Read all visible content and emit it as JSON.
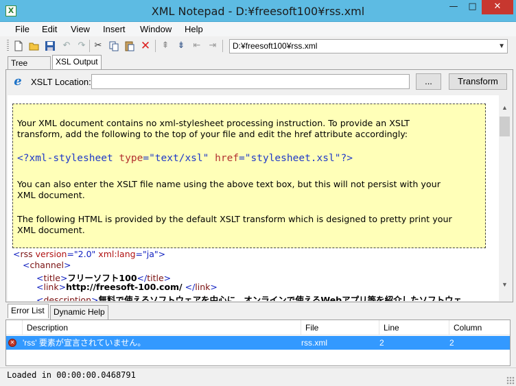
{
  "window": {
    "app_icon": "X",
    "title": "XML Notepad - D:¥freesoft100¥rss.xml",
    "minimize": "—",
    "maximize": "□",
    "close": "✕"
  },
  "menu": [
    "File",
    "Edit",
    "View",
    "Insert",
    "Window",
    "Help"
  ],
  "toolbar": {
    "icons": [
      "new-file-icon",
      "open-folder-icon",
      "save-icon",
      "undo-icon",
      "redo-icon",
      "cut-icon",
      "copy-icon",
      "paste-icon",
      "delete-icon",
      "nudge-up-icon",
      "nudge-down-icon",
      "nudge-left-icon",
      "nudge-right-icon"
    ],
    "path": "D:¥freesoft100¥rss.xml"
  },
  "tabs": [
    "Tree View",
    "XSL Output"
  ],
  "xslt": {
    "label": "XSLT Location:",
    "value": "",
    "browse_button": "...",
    "transform_button": "Transform"
  },
  "notice": {
    "line1": "Your XML document contains no xml-stylesheet processing instruction. To provide an XSLT",
    "line2": "transform, add the following to the top of your file and edit the href attribute accordingly:",
    "pi": {
      "open": "<?xml-stylesheet",
      "attr1": "type",
      "val1": "\"text/xsl\"",
      "attr2": "href",
      "val2": "\"stylesheet.xsl\"",
      "close": "?>"
    },
    "line3": "You can also enter the XSLT file name using the above text box, but this will not persist with your",
    "line4": "XML document.",
    "line5": "The following HTML is provided by the default XSLT transform which is designed to pretty print your",
    "line6": "XML document."
  },
  "xml": {
    "rss_tag": "rss",
    "rss_attr1": "version",
    "rss_val1": "\"2.0\"",
    "rss_attr2": "xml:lang",
    "rss_val2": "\"ja\"",
    "channel_tag": "channel",
    "title_tag": "title",
    "title_text": "フリーソフト100",
    "link_tag": "link",
    "link_text": "http://freesoft-100.com/",
    "desc_tag": "description",
    "desc_text": "無料で使えるソフトウェアを中心に、オンラインで使えるWebアプリ等を紹介したソフトウェ"
  },
  "bottom_tabs": [
    "Error List",
    "Dynamic Help"
  ],
  "error_list": {
    "columns": [
      "Description",
      "File",
      "Line",
      "Column"
    ],
    "rows": [
      {
        "description": "'rss' 要素が宣言されていません。",
        "file": "rss.xml",
        "line": "2",
        "column": "2"
      }
    ]
  },
  "status": "Loaded in 00:00:00.0468791"
}
